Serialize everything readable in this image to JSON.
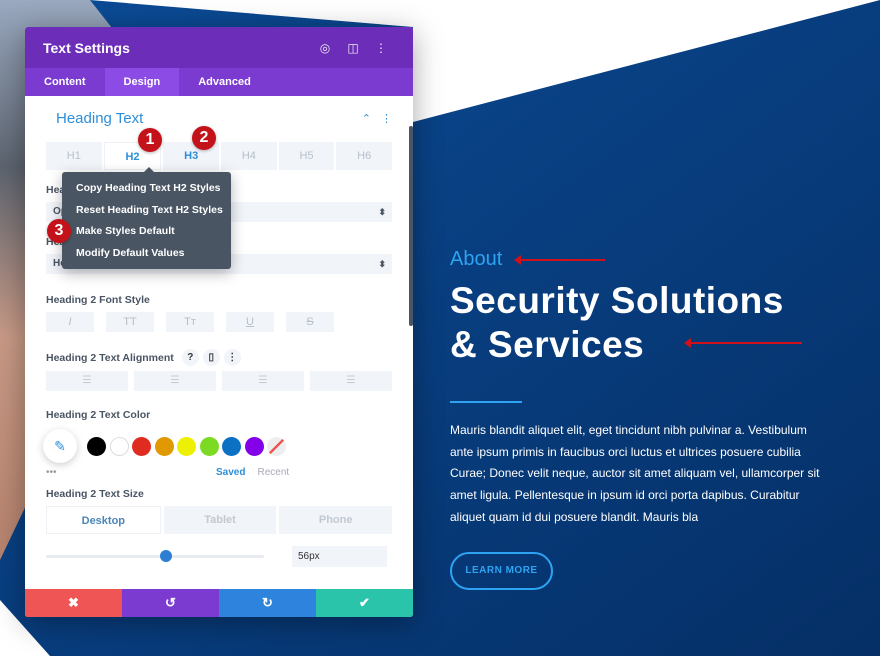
{
  "modal": {
    "title": "Text Settings",
    "tabs": [
      "Content",
      "Design",
      "Advanced"
    ],
    "active_tab": "Design"
  },
  "section": {
    "title": "Heading Text",
    "heading_tabs": [
      "H1",
      "H2",
      "H3",
      "H4",
      "H5",
      "H6"
    ],
    "active_heading": "H2"
  },
  "fields": {
    "font_label": "Heading 2 Font",
    "font_value": "Open Sans",
    "weight_label": "Heading 2 Font Weight",
    "weight_value": "Heavy",
    "style_label": "Heading 2 Font Style",
    "style_buttons": [
      "I",
      "TT",
      "Tт",
      "U",
      "S"
    ],
    "align_label": "Heading 2 Text Alignment",
    "align_help": "?",
    "color_label": "Heading 2 Text Color",
    "color_swatches": [
      "#000000",
      "#ffffff",
      "#e02b20",
      "#e09900",
      "#edf000",
      "#7cda24",
      "#0c71c3",
      "#8300e9"
    ],
    "saved": "Saved",
    "recent": "Recent",
    "more": "•••",
    "size_label": "Heading 2 Text Size",
    "devices": [
      "Desktop",
      "Tablet",
      "Phone"
    ],
    "active_device": "Desktop",
    "size_value": "56px",
    "slider_fraction": 0.55
  },
  "context_menu": [
    "Copy Heading Text H2 Styles",
    "Reset Heading Text H2 Styles",
    "Make Styles Default",
    "Modify Default Values"
  ],
  "badges": [
    "1",
    "2",
    "3"
  ],
  "footer": {
    "cancel": "✖",
    "undo": "↺",
    "redo": "↻",
    "save": "✔",
    "colors": [
      "#ef5555",
      "#7b3bd0",
      "#2e84dc",
      "#29c4a9"
    ]
  },
  "hero": {
    "eyebrow": "About",
    "title_line1": "Security Solutions",
    "title_line2": "& Services",
    "paragraph": "Mauris blandit aliquet elit, eget tincidunt nibh pulvinar a. Vestibulum ante ipsum primis in faucibus orci luctus et ultrices posuere cubilia Curae; Donec velit neque, auctor sit amet aliquam vel, ullamcorper sit amet ligula. Pellentesque in ipsum id orci porta dapibus. Curabitur aliquet quam id dui posuere blandit. Mauris bla",
    "button": "LEARN MORE"
  },
  "accent": "#2ea3f2"
}
